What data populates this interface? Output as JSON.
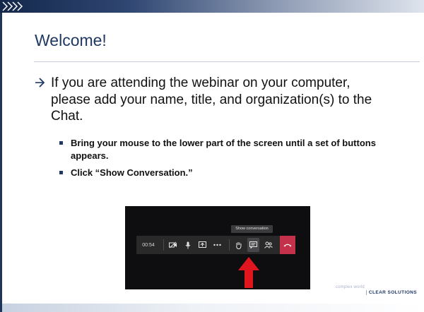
{
  "slide": {
    "title": "Welcome!",
    "main_bullet": "If you are attending the webinar on your computer, please add your name, title, and organization(s) to the Chat.",
    "sub_bullets": [
      "Bring your mouse to the lower part of the screen until a set of buttons appears.",
      "Click “Show Conversation.”"
    ]
  },
  "teams_controls": {
    "tooltip": "Show conversation",
    "timer": "00:54",
    "buttons": [
      "camera-off-icon",
      "microphone-icon",
      "share-screen-icon",
      "more-options-icon",
      "raise-hand-icon",
      "show-conversation-icon",
      "participants-icon",
      "hang-up-icon"
    ]
  },
  "brand": {
    "tagline": "complex world",
    "name": "CLEAR SOLUTIONS"
  },
  "colors": {
    "title": "#1f3864",
    "accent_dark": "#14284b",
    "hangup": "#c4314b",
    "pointer_arrow": "#e0161f"
  }
}
